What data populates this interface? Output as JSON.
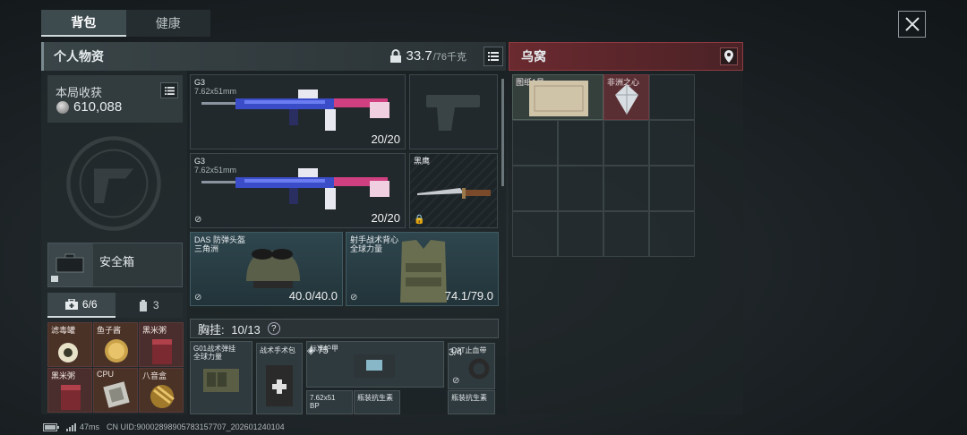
{
  "tabs": [
    {
      "label": "背包",
      "active": true
    },
    {
      "label": "健康",
      "active": false
    }
  ],
  "personal": {
    "title": "个人物资",
    "weight": "33.7",
    "weight_max": "/76千克"
  },
  "earnings": {
    "label": "本局收获",
    "value": "610,088"
  },
  "safe_box": {
    "label": "安全箱"
  },
  "sub_tabs": [
    {
      "label": "6/6",
      "icon": "medkit-icon",
      "active": true
    },
    {
      "label": "3",
      "icon": "canister-icon",
      "active": false
    }
  ],
  "safe_items": [
    {
      "label": "滤毒罐",
      "kind": "canister"
    },
    {
      "label": "鱼子酱",
      "kind": "tin"
    },
    {
      "label": "黑米粥",
      "kind": "box"
    },
    {
      "label": "黑米粥",
      "kind": "box"
    },
    {
      "label": "CPU",
      "kind": "chip"
    },
    {
      "label": "八音盒",
      "kind": "musicbox"
    }
  ],
  "weapons": [
    {
      "name": "G3",
      "caliber": "7.62x51mm",
      "ammo": "20/20"
    },
    {
      "name": "G3",
      "caliber": "7.62x51mm",
      "ammo": "20/20"
    }
  ],
  "pistol_slot": {
    "name": ""
  },
  "melee_slot": {
    "name": "黑鹰"
  },
  "helmet": {
    "name": "DAS 防弹头盔",
    "sub": "三角洲",
    "durability": "40.0/40.0"
  },
  "vest": {
    "name": "射手战术背心",
    "sub": "全球力量",
    "durability": "74.1/79.0"
  },
  "rig": {
    "title": "胸挂:",
    "count": "10/13",
    "help": "?",
    "items": [
      {
        "name": "G01战术弹挂",
        "sub": "全球力量"
      },
      {
        "name": "战术手术包",
        "sub": ""
      },
      {
        "name": "标准护甲",
        "sub": "",
        "value": "75"
      },
      {
        "name": "CAT止血带",
        "sub": "",
        "value": "3/4"
      },
      {
        "name": "7.62x51",
        "sub": "BP",
        "value": ""
      },
      {
        "name": "瓶装抗生素",
        "sub": "",
        "value": ""
      },
      {
        "name": "瓶装抗生素",
        "sub": "",
        "value": ""
      }
    ]
  },
  "crow_nest": {
    "title": "乌窝",
    "items": [
      {
        "label": "图纸1号"
      },
      {
        "label": "非洲之心"
      }
    ]
  },
  "status_bar": {
    "ping": "47ms",
    "uid": "CN UID:90002898905783157707_202601240104"
  },
  "colors": {
    "accent_red": "#6a2a2f",
    "armor_blue": "#2f464e",
    "safe_red": "#4a2d2d"
  }
}
